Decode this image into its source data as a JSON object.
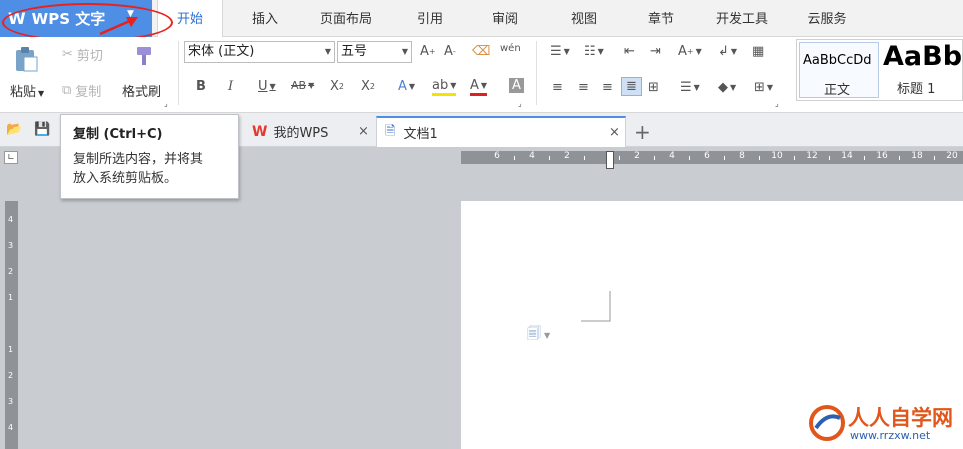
{
  "app": {
    "name": "WPS 文字",
    "logo": "W"
  },
  "menu_tabs": [
    "开始",
    "插入",
    "页面布局",
    "引用",
    "审阅",
    "视图",
    "章节",
    "开发工具",
    "云服务"
  ],
  "clipboard": {
    "paste": "粘贴",
    "cut": "剪切",
    "copy": "复制",
    "format_painter": "格式刷"
  },
  "font": {
    "family": "宋体 (正文)",
    "size": "五号"
  },
  "styles": {
    "normal_preview": "AaBbCcDd",
    "normal_label": "正文",
    "heading_preview": "AaBb",
    "heading_label": "标题 1"
  },
  "doc_tabs": [
    {
      "label": "我的WPS"
    },
    {
      "label": "文档1"
    }
  ],
  "tooltip": {
    "title": "复制 (Ctrl+C)",
    "line1": "复制所选内容，并将其",
    "line2": "放入系统剪贴板。"
  },
  "ruler_h": [
    "6",
    "4",
    "2",
    "",
    "2",
    "4",
    "6",
    "8",
    "10",
    "12",
    "14",
    "16",
    "18",
    "20"
  ],
  "ruler_v": [
    "4",
    "3",
    "2",
    "1",
    "",
    "1",
    "2",
    "3",
    "4"
  ],
  "watermark": {
    "name": "人人自学网",
    "url": "www.rrzxw.net"
  },
  "colors": {
    "accent": "#4e8ee5",
    "highlight": "#e8211d"
  }
}
